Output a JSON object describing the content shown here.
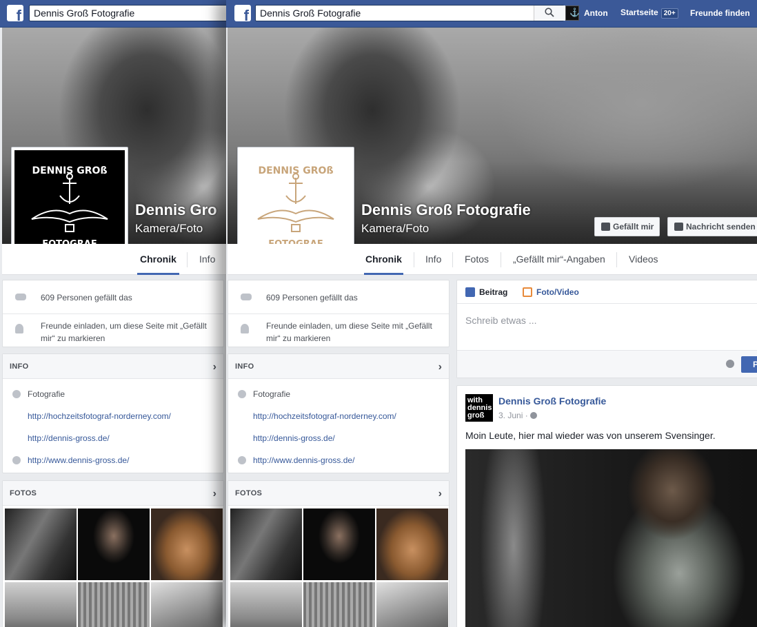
{
  "search": {
    "value": "Dennis Groß Fotografie"
  },
  "topnav": {
    "user": "Anton",
    "home": "Startseite",
    "home_badge": "20+",
    "find_friends": "Freunde finden"
  },
  "page": {
    "name": "Dennis Groß Fotografie",
    "name_truncated": "Dennis Gro",
    "category": "Kamera/Foto"
  },
  "logo": {
    "line1": "DENNIS GROß",
    "line2": "FOTOGRAF"
  },
  "cover_buttons": {
    "like": "Gefällt mir",
    "message": "Nachricht senden"
  },
  "tabs": [
    {
      "label": "Chronik"
    },
    {
      "label": "Info"
    },
    {
      "label": "Fotos"
    },
    {
      "label": "„Gefällt mir“-Angaben"
    },
    {
      "label": "Videos"
    }
  ],
  "likes": {
    "count_text": "609 Personen gefällt das",
    "invite_text": "Freunde einladen, um diese Seite mit „Gefällt mir“ zu markieren"
  },
  "info": {
    "heading": "INFO",
    "category": "Fotografie",
    "links": [
      "http://hochzeitsfotograf-norderney.com/",
      "http://dennis-gross.de/",
      "http://www.dennis-gross.de/"
    ]
  },
  "photos": {
    "heading": "FOTOS"
  },
  "composer": {
    "tab_post": "Beitrag",
    "tab_photo": "Foto/Video",
    "placeholder": "Schreib etwas ...",
    "post_button": "P"
  },
  "post": {
    "avatar_text": "with dennis groß",
    "author": "Dennis Groß Fotografie",
    "date": "3. Juni ·",
    "text": "Moin Leute, hier mal wieder was von unserem Svensinger."
  },
  "colors": {
    "brand": "#3b5998",
    "link": "#365899",
    "logo_tan": "#c8a57a"
  }
}
